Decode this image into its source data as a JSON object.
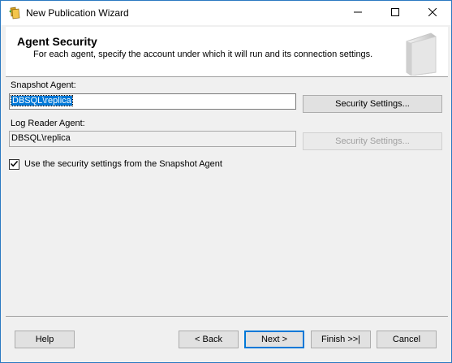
{
  "window": {
    "title": "New Publication Wizard",
    "icon": "wizard-app-icon",
    "controls": [
      "minimize-icon",
      "maximize-icon",
      "close-icon"
    ]
  },
  "header": {
    "title": "Agent Security",
    "subtitle": "For each agent, specify the account under which it will run and its connection settings."
  },
  "snapshot_agent": {
    "label": "Snapshot Agent:",
    "value": "DBSQL\\replica",
    "button": "Security Settings..."
  },
  "log_reader_agent": {
    "label": "Log Reader Agent:",
    "value": "DBSQL\\replica",
    "button": "Security Settings..."
  },
  "use_snapshot_settings": {
    "label": "Use the security settings from the Snapshot Agent",
    "checked": true
  },
  "footer": {
    "help": "Help",
    "back": "< Back",
    "next": "Next >",
    "finish": "Finish >>|",
    "cancel": "Cancel"
  },
  "colors": {
    "accent": "#0078d7",
    "window_bg": "#f0f0f0",
    "header_bg": "#ffffff"
  }
}
